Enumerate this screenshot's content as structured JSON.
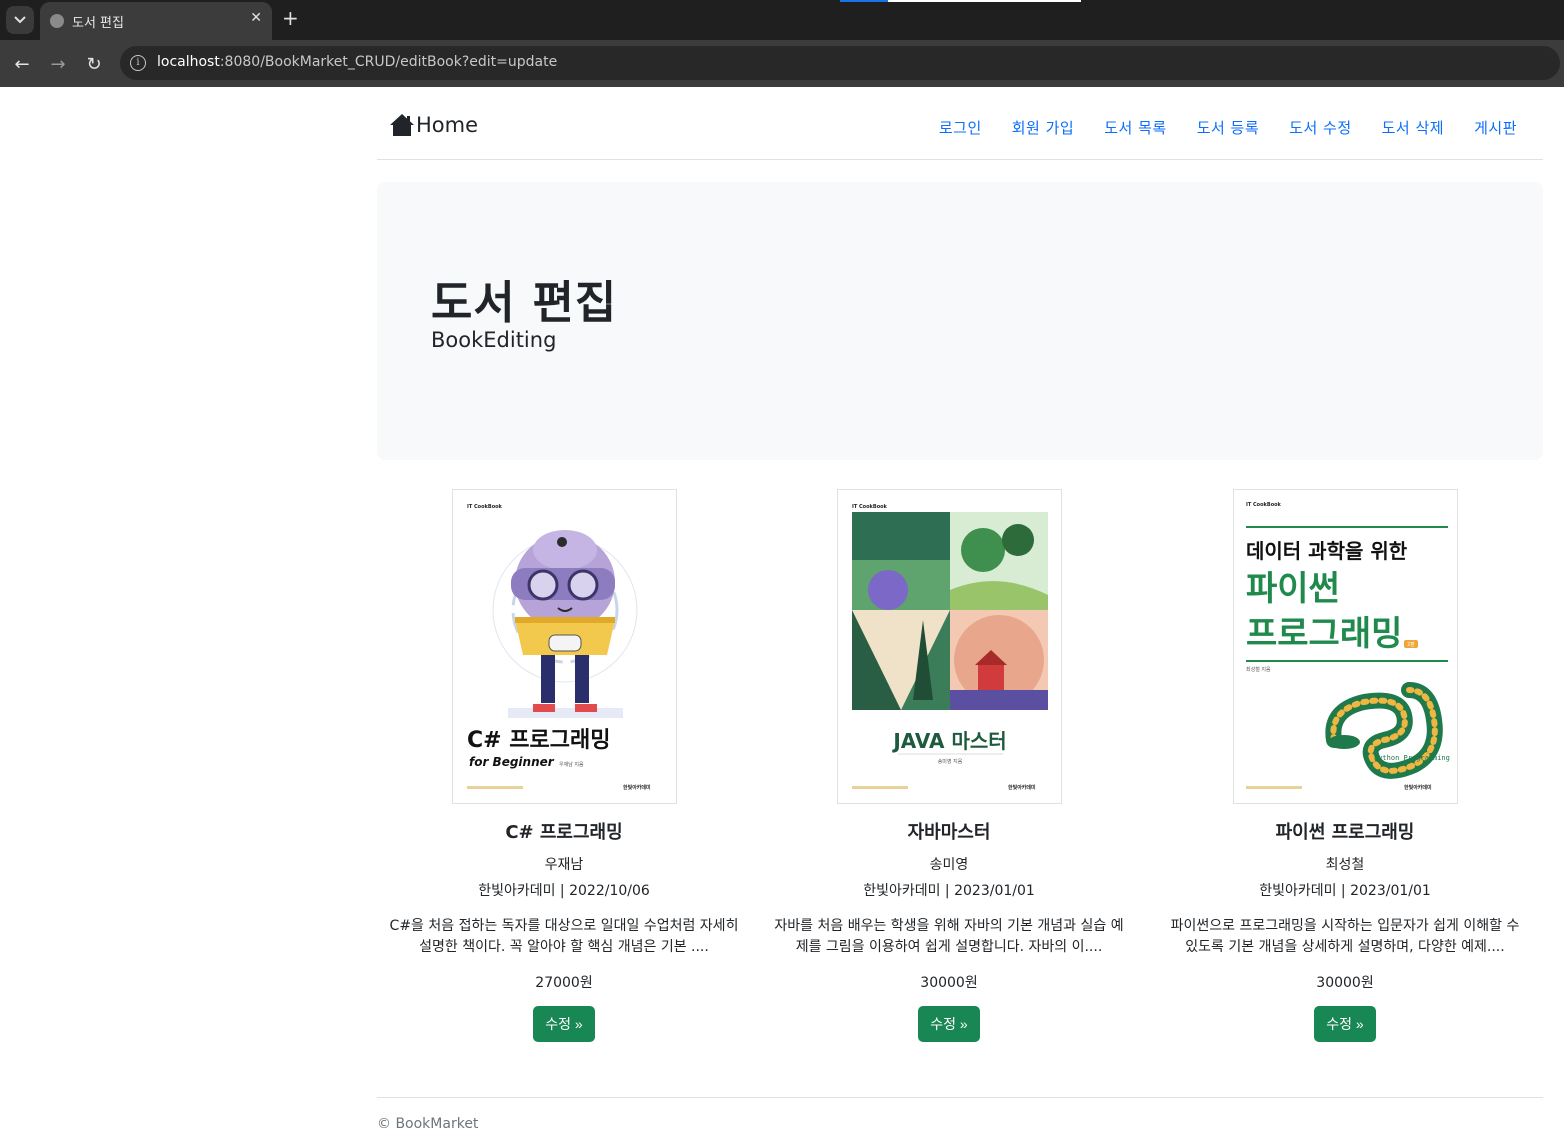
{
  "browser": {
    "tab_title": "도서 편집",
    "url_host": "localhost",
    "url_rest": ":8080/BookMarket_CRUD/editBook?edit=update"
  },
  "navbar": {
    "brand": "Home",
    "links": [
      "로그인",
      "회원 가입",
      "도서 목록",
      "도서 등록",
      "도서 수정",
      "도서 삭제",
      "게시판"
    ]
  },
  "jumbotron": {
    "title": "도서 편집",
    "subtitle": "BookEditing"
  },
  "books": [
    {
      "title": "C# 프로그래밍",
      "author": "우재남",
      "publisher_date": "한빛아카데미 | 2022/10/06",
      "description": "C#을 처음 접하는 독자를 대상으로 일대일 수업처럼 자세히 설명한 책이다. 꼭 알아야 할 핵심 개념은 기본 ....",
      "price": "27000원",
      "button": "수정 »",
      "cover_title": "C# 프로그래밍",
      "cover_subtitle": "for Beginner",
      "cover_author": "우재남 지음",
      "cover_brand": "IT CookBook",
      "cover_publisher": "한빛아카데미"
    },
    {
      "title": "자바마스터",
      "author": "송미영",
      "publisher_date": "한빛아카데미 | 2023/01/01",
      "description": "자바를 처음 배우는 학생을 위해 자바의 기본 개념과 실습 예제를 그림을 이용하여 쉽게 설명합니다. 자바의 이....",
      "price": "30000원",
      "button": "수정 »",
      "cover_title": "JAVA 마스터",
      "cover_author": "송미영 지음",
      "cover_brand": "IT CookBook",
      "cover_publisher": "한빛아카데미"
    },
    {
      "title": "파이썬 프로그래밍",
      "author": "최성철",
      "publisher_date": "한빛아카데미 | 2023/01/01",
      "description": "파이썬으로 프로그래밍을 시작하는 입문자가 쉽게 이해할 수 있도록 기본 개념을 상세하게 설명하며, 다양한 예제....",
      "price": "30000원",
      "button": "수정 »",
      "cover_line1": "데이터 과학을 위한",
      "cover_line2": "파이썬",
      "cover_line3": "프로그래밍",
      "cover_edition": "2판",
      "cover_author": "최성철 지음",
      "cover_python": "Python Programming",
      "cover_brand": "IT CookBook",
      "cover_publisher": "한빛아카데미"
    }
  ],
  "footer": {
    "text": "© BookMarket"
  },
  "colors": {
    "link": "#0d6efd",
    "button": "#198754",
    "jumbotron_bg": "#f8f9fa"
  }
}
